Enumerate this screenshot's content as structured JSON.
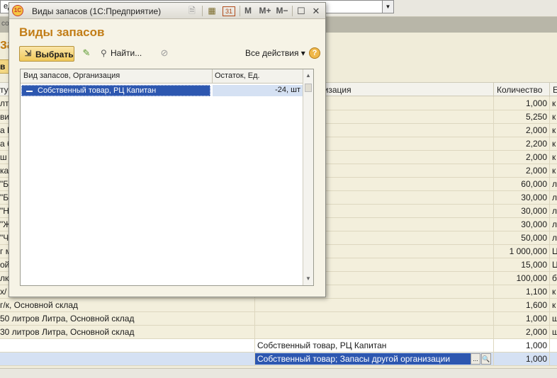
{
  "background": {
    "top_combo_text": "ед",
    "band_text": "со",
    "title_fragment": "за",
    "button_fragment": "в",
    "grid": {
      "headers": [
        "ту",
        "низация",
        "Количество",
        "Е"
      ],
      "rows": [
        {
          "c1": "лт",
          "c2": "",
          "c3": "1,000",
          "c4": "к"
        },
        {
          "c1": "ви",
          "c2": "",
          "c3": "5,250",
          "c4": "к"
        },
        {
          "c1": "а Н",
          "c2": "",
          "c3": "2,000",
          "c4": "к"
        },
        {
          "c1": "а б",
          "c2": "",
          "c3": "2,200",
          "c4": "к"
        },
        {
          "c1": "ш",
          "c2": "",
          "c3": "2,000",
          "c4": "к"
        },
        {
          "c1": "ка",
          "c2": "",
          "c3": "2,000",
          "c4": "к"
        },
        {
          "c1": "\"Б",
          "c2": "",
          "c3": "60,000",
          "c4": "л"
        },
        {
          "c1": "\"Б",
          "c2": "",
          "c3": "30,000",
          "c4": "л"
        },
        {
          "c1": "\"Н",
          "c2": "",
          "c3": "30,000",
          "c4": "л"
        },
        {
          "c1": "\"Ж",
          "c2": "",
          "c3": "30,000",
          "c4": "л"
        },
        {
          "c1": "\"Ч",
          "c2": "",
          "c3": "50,000",
          "c4": "л"
        },
        {
          "c1": "г м",
          "c2": "",
          "c3": "1 000,000",
          "c4": "Ц"
        },
        {
          "c1": "ой",
          "c2": "",
          "c3": "15,000",
          "c4": "Ц"
        },
        {
          "c1": "лк",
          "c2": "",
          "c3": "100,000",
          "c4": "б"
        },
        {
          "c1": "х/",
          "c2": "",
          "c3": "1,100",
          "c4": "к"
        },
        {
          "c1": "г/к, Основной склад",
          "c2": "",
          "c3": "1,600",
          "c4": "к"
        },
        {
          "c1": "50 литров Литра, Основной склад",
          "c2": "",
          "c3": "1,000",
          "c4": "ш"
        },
        {
          "c1": "30 литров Литра, Основной склад",
          "c2": "",
          "c3": "2,000",
          "c4": "ш"
        },
        {
          "c1": "",
          "c2": "Собственный товар, РЦ Капитан",
          "c3": "1,000",
          "c4": ""
        },
        {
          "c1": "",
          "c2": "Собственный товар; Запасы другой организации",
          "c3": "1,000",
          "c4": ""
        }
      ],
      "edit_buttons": [
        "...",
        "🔍"
      ]
    }
  },
  "dialog": {
    "window_title": "Виды запасов  (1С:Предприятие)",
    "logo_text": "1С",
    "titlebar_icons": {
      "save": "🗎",
      "calculator": "▦",
      "calendar": "31",
      "m": "M",
      "m_plus": "M+",
      "m_minus": "M−",
      "maximize": "☐",
      "close": "✕"
    },
    "header": "Виды запасов",
    "toolbar": {
      "select_label": "Выбрать",
      "find_label": "Найти...",
      "all_actions_label": "Все действия ▾",
      "help_label": "?"
    },
    "table": {
      "col1": "Вид запасов, Организация",
      "col2": "Остаток, Ед.",
      "rows": [
        {
          "name": "Собственный товар, РЦ Капитан",
          "balance": "-24, шт"
        }
      ]
    }
  }
}
